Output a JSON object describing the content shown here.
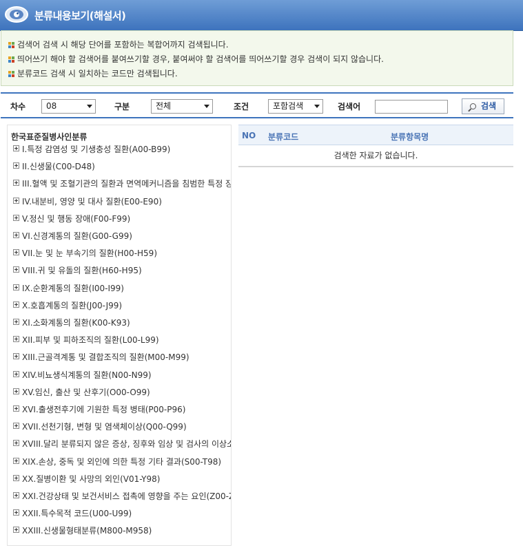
{
  "header": {
    "title": "분류내용보기(해설서)",
    "icon": "eye-icon"
  },
  "info": {
    "lines": [
      "검색어 검색 시 해당 단어를 포함하는 복합어까지 검색됩니다.",
      "띄어쓰기 해야 할 검색어를 붙여쓰기할 경우, 붙여써야 할 검색어를 띄어쓰기할 경우 검색이 되지 않습니다.",
      "분류코드 검색 시 일치하는 코드만 검색됩니다."
    ]
  },
  "search": {
    "order_label": "차수",
    "order_value": "08",
    "type_label": "구분",
    "type_value": "전체",
    "condition_label": "조건",
    "condition_value": "포함검색",
    "keyword_label": "검색어",
    "keyword_value": "",
    "button_label": "검색"
  },
  "tree": {
    "root": "한국표준질병사인분류",
    "items": [
      "I.특정 감염성 및 기생충성 질환(A00-B99)",
      "II.신생물(C00-D48)",
      "III.혈액 및 조혈기관의 질환과 면역메커니즘을 침범한 특정 장",
      "IV.내분비, 영양 및 대사 질환(E00-E90)",
      "V.정신 및 행동 장애(F00-F99)",
      "VI.신경계통의 질환(G00-G99)",
      "VII.눈 및 눈 부속기의 질환(H00-H59)",
      "VIII.귀 및 유돌의 질환(H60-H95)",
      "IX.순환계통의 질환(I00-I99)",
      "X.호흡계통의 질환(J00-J99)",
      "XI.소화계통의 질환(K00-K93)",
      "XII.피부 및 피하조직의 질환(L00-L99)",
      "XIII.근골격계통 및 결합조직의 질환(M00-M99)",
      "XIV.비뇨생식계통의 질환(N00-N99)",
      "XV.임신, 출산 및 산후기(O00-O99)",
      "XVI.출생전후기에 기원한 특정 병태(P00-P96)",
      "XVII.선천기형, 변형 및 염색체이상(Q00-Q99)",
      "XVIII.달리 분류되지 않은 증상, 징후와 임상 및 검사의 이상소",
      "XIX.손상, 중독 및 외인에 의한 특정 기타 결과(S00-T98)",
      "XX.질병이환 및 사망의 외인(V01-Y98)",
      "XXI.건강상태 및 보건서비스 접촉에 영향을 주는 요인(Z00-Z",
      "XXII.특수목적 코드(U00-U99)",
      "XXIII.신생물형태분류(M800-M958)"
    ]
  },
  "results": {
    "col_no": "NO",
    "col_code": "분류코드",
    "col_name": "분류항목명",
    "empty_message": "검색한 자료가 없습니다."
  }
}
